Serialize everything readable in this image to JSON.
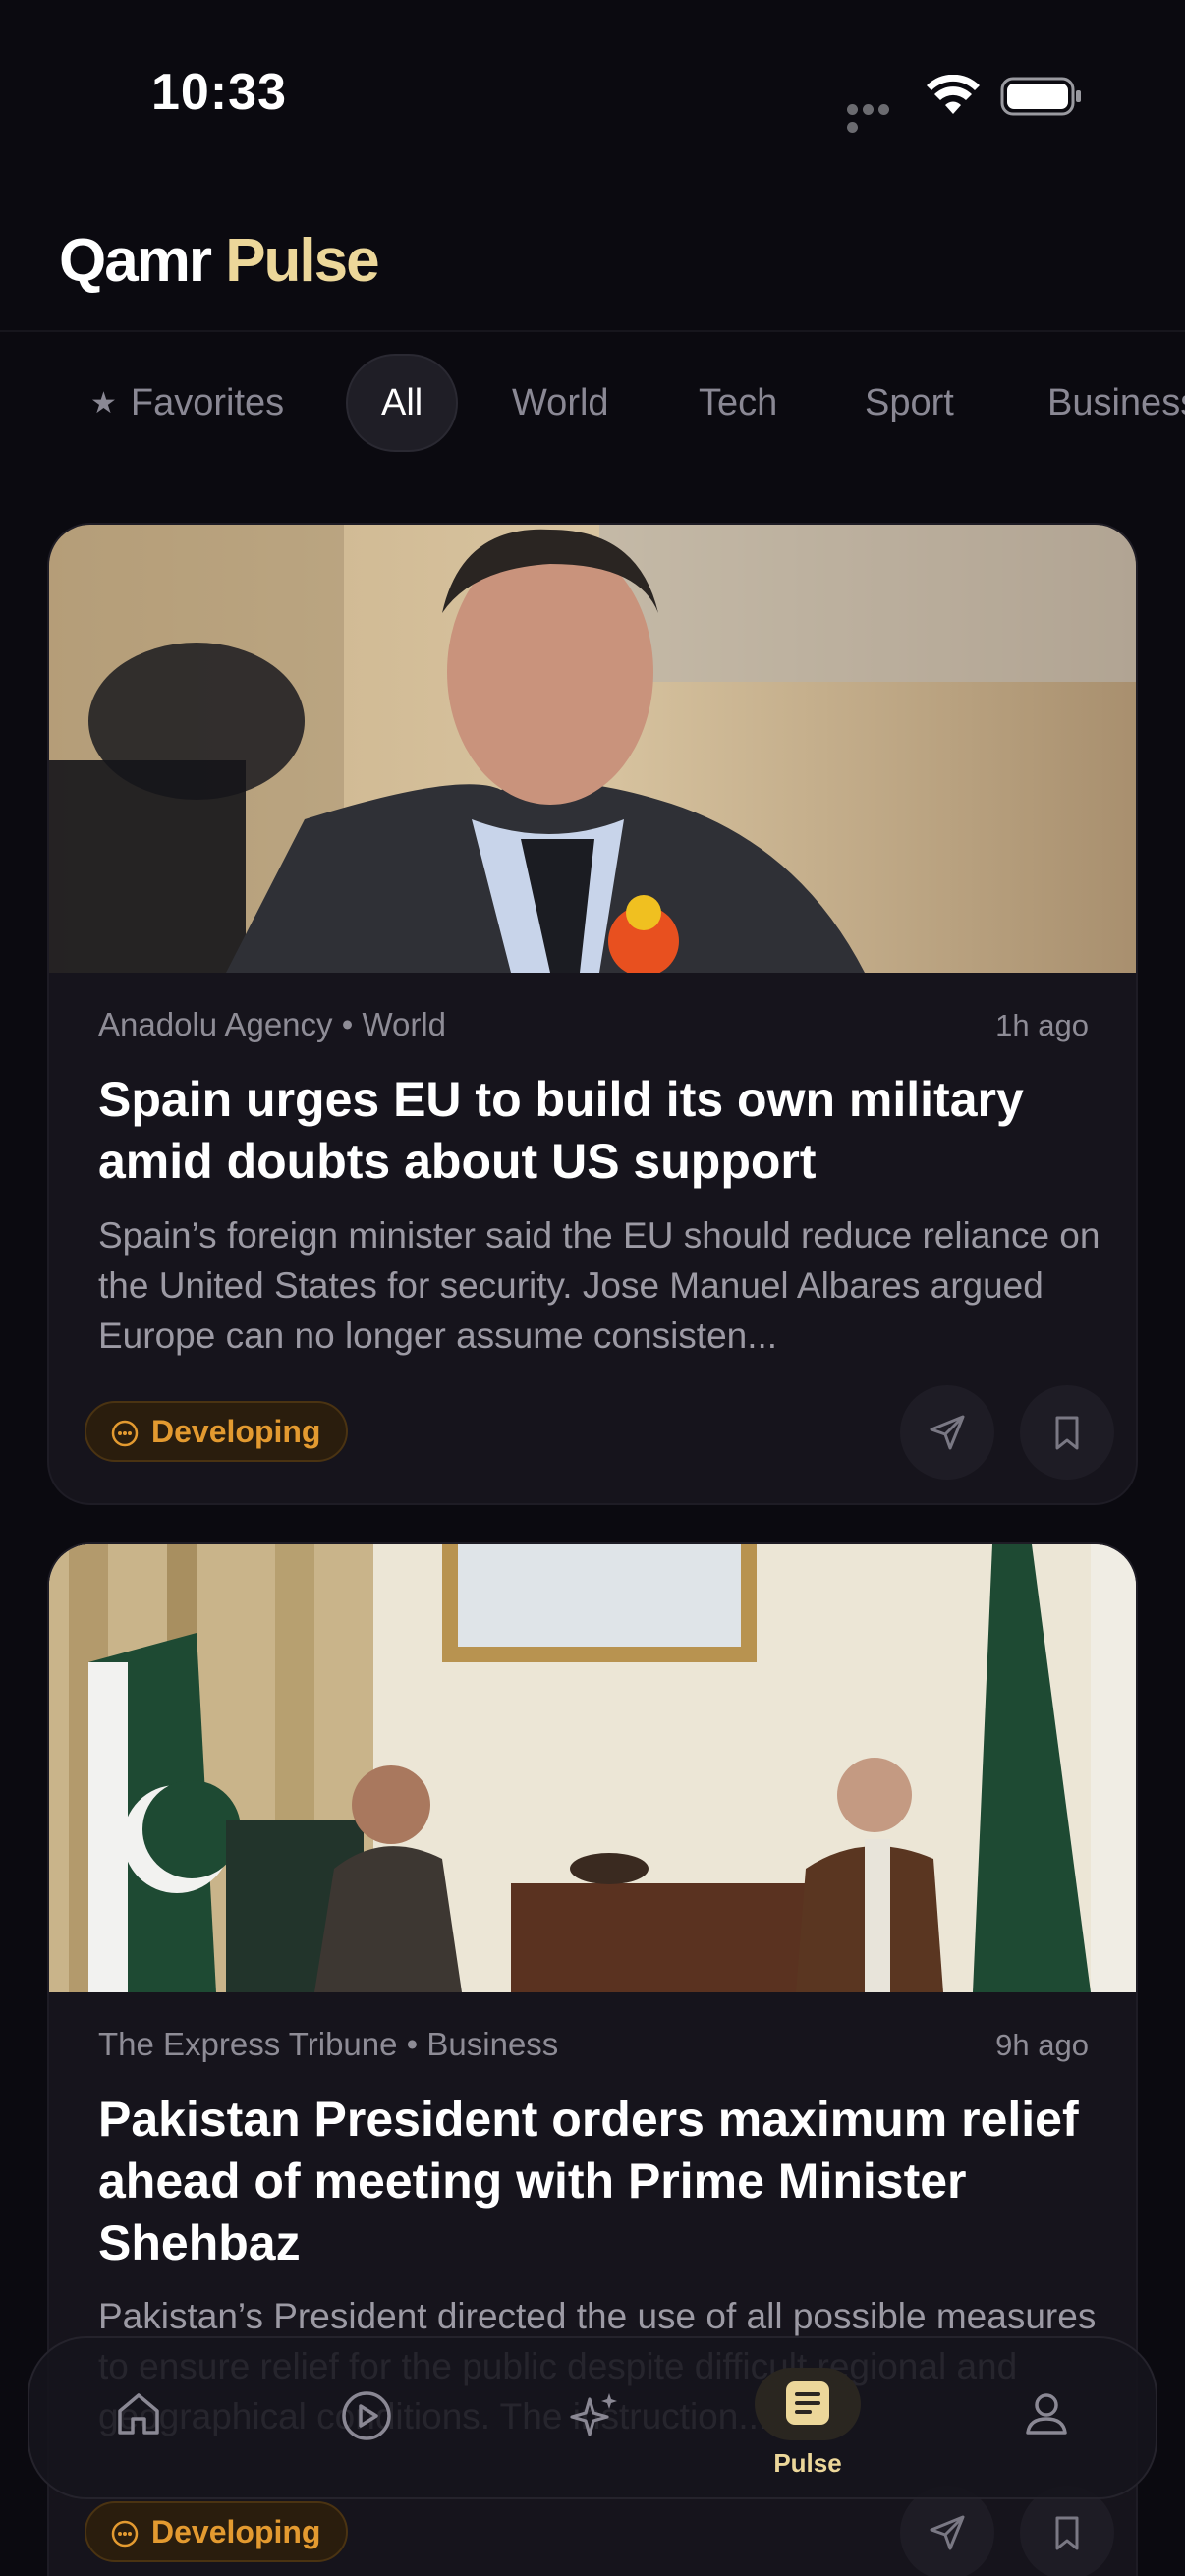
{
  "status_bar": {
    "time": "10:33"
  },
  "header": {
    "brand_primary": "Qamr",
    "brand_accent": "Pulse",
    "accent_color": "#ecd79a"
  },
  "tabs": [
    {
      "label": "Favorites",
      "icon": "star-icon",
      "active": false
    },
    {
      "label": "All",
      "active": true
    },
    {
      "label": "World",
      "active": false
    },
    {
      "label": "Tech",
      "active": false
    },
    {
      "label": "Sport",
      "active": false
    },
    {
      "label": "Business",
      "active": false
    }
  ],
  "articles": [
    {
      "source": "Anadolu Agency",
      "separator": "•",
      "category": "World",
      "time": "1h ago",
      "title": "Spain urges EU to build its own military amid doubts about US support",
      "summary": "Spain’s foreign minister said the EU should reduce reliance on the United States for security. Jose Manuel Albares argued Europe can no longer assume consisten...",
      "badge": "Developing"
    },
    {
      "source": "The Express Tribune",
      "separator": "•",
      "category": "Business",
      "time": "9h ago",
      "title": "Pakistan President orders maximum relief ahead of meeting with Prime Minister Shehbaz",
      "summary": "Pakistan’s President directed the use of all possible measures to ensure relief for the public despite difficult regional and geographical conditions. The instruction...",
      "badge": "Developing"
    }
  ],
  "bottom_nav": {
    "items": [
      {
        "icon": "home-icon"
      },
      {
        "icon": "play-circle-icon"
      },
      {
        "icon": "sparkles-icon"
      },
      {
        "icon": "document-icon",
        "label": "Pulse",
        "active": true
      },
      {
        "icon": "profile-icon"
      }
    ]
  }
}
